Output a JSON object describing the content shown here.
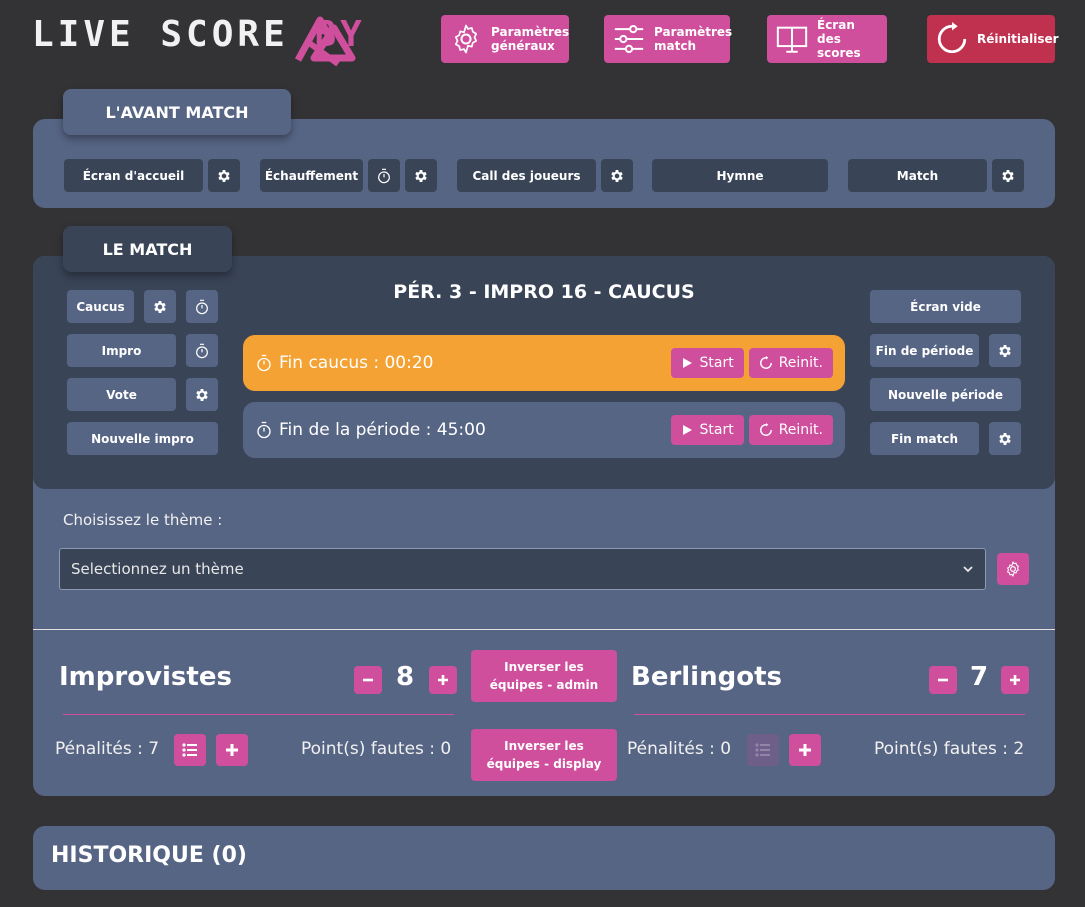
{
  "header": {
    "logo_text": "LIVE SCORE",
    "logo_by": "BY",
    "buttons": [
      {
        "label_line1": "Paramètres",
        "label_line2": "généraux"
      },
      {
        "label_line1": "Paramètres",
        "label_line2": "match"
      },
      {
        "label_line1": "Écran",
        "label_line2": "des scores"
      },
      {
        "label_line1": "Réinitialiser",
        "label_line2": ""
      }
    ]
  },
  "avant_match": {
    "title": "L'AVANT MATCH",
    "buttons": [
      "Écran d'accueil",
      "Échauffement",
      "Call des joueurs",
      "Hymne",
      "Match"
    ]
  },
  "match": {
    "title": "LE MATCH",
    "status": "PÉR. 3 - IMPRO 16 - CAUCUS",
    "left_buttons": [
      "Caucus",
      "Impro",
      "Vote",
      "Nouvelle impro"
    ],
    "right_buttons": [
      "Écran vide",
      "Fin de période",
      "Nouvelle période",
      "Fin match"
    ],
    "timers": [
      {
        "label": "Fin caucus : 00:20",
        "start": "Start",
        "reset": "Reinit."
      },
      {
        "label": "Fin de la période : 45:00",
        "start": "Start",
        "reset": "Reinit."
      }
    ]
  },
  "theme": {
    "label": "Choisissez le thème :",
    "selected": "Selectionnez un thème"
  },
  "teams": {
    "left": {
      "name": "Improvistes",
      "score": "8",
      "penalties": "Pénalités : 7",
      "fouls": "Point(s) fautes : 0"
    },
    "right": {
      "name": "Berlingots",
      "score": "7",
      "penalties": "Pénalités : 0",
      "fouls": "Point(s) fautes : 2"
    },
    "swap_admin": "Inverser les équipes - admin",
    "swap_display": "Inverser les équipes - display"
  },
  "history": {
    "title": "HISTORIQUE (0)"
  },
  "colors": {
    "background": "#333336",
    "card": "#576585",
    "card_dark": "#394457",
    "accent": "#cf4f9d",
    "danger": "#c0304f",
    "timer_active": "#f3a233"
  }
}
